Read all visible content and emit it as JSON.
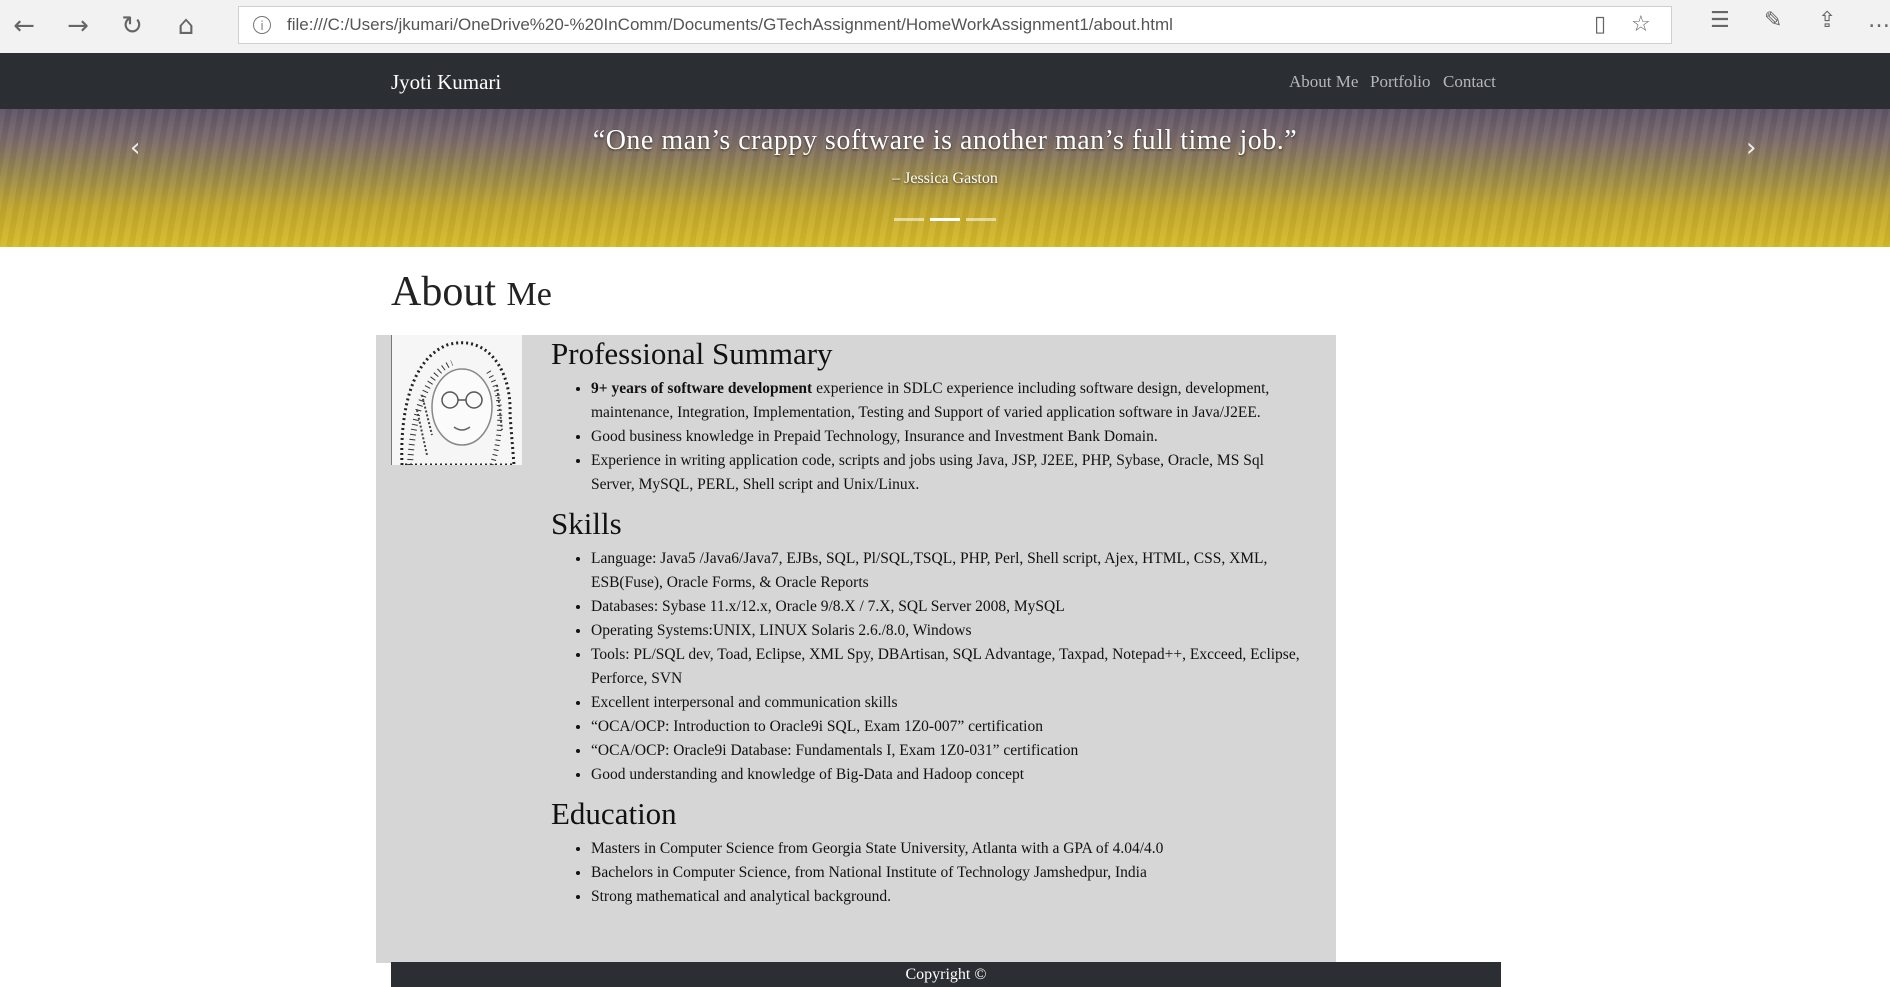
{
  "browser": {
    "url": "file:///C:/Users/jkumari/OneDrive%20-%20InComm/Documents/GTechAssignment/HomeWorkAssignment1/about.html",
    "icons": [
      "back-icon",
      "forward-icon",
      "refresh-icon",
      "home-icon",
      "info-icon",
      "reading-view-icon",
      "favorite-star-icon",
      "favorites-list-icon",
      "pen-icon",
      "share-icon",
      "more-icon"
    ]
  },
  "nav": {
    "brand": "Jyoti Kumari",
    "links": [
      "About Me",
      "Portfolio",
      "Contact"
    ]
  },
  "carousel": {
    "quote": "“One man’s crappy software is another man’s full time job.”",
    "author": "– Jessica Gaston",
    "prev_glyph": "‹",
    "next_glyph": "›",
    "active_index": 1,
    "slide_count": 3
  },
  "page": {
    "title_word1": "About",
    "title_word2": "Me"
  },
  "sections": {
    "summary": {
      "heading": "Professional Summary",
      "item1_bold": "9+ years of software development",
      "item1_rest": " experience in SDLC experience including software design, development, maintenance, Integration, Implementation, Testing and Support of varied application software in Java/J2EE.",
      "items": [
        "Good business knowledge in Prepaid Technology, Insurance and Investment Bank Domain.",
        "Experience in writing application code, scripts and jobs using Java, JSP, J2EE, PHP, Sybase, Oracle, MS Sql Server, MySQL, PERL, Shell script and Unix/Linux."
      ]
    },
    "skills": {
      "heading": "Skills",
      "items": [
        "Language: Java5 /Java6/Java7, EJBs, SQL, Pl/SQL,TSQL, PHP, Perl, Shell script, Ajex, HTML, CSS, XML, ESB(Fuse), Oracle Forms, & Oracle Reports",
        "Databases: Sybase 11.x/12.x, Oracle 9/8.X / 7.X, SQL Server 2008, MySQL",
        "Operating Systems:UNIX, LINUX Solaris 2.6./8.0, Windows",
        "Tools: PL/SQL dev, Toad, Eclipse, XML Spy, DBArtisan, SQL Advantage, Taxpad, Notepad++, Excceed, Eclipse, Perforce, SVN",
        "Excellent interpersonal and communication skills",
        "“OCA/OCP: Introduction to Oracle9i SQL, Exam 1Z0-007” certification",
        "“OCA/OCP: Oracle9i Database: Fundamentals I, Exam 1Z0-031” certification",
        "Good understanding and knowledge of Big-Data and Hadoop concept"
      ]
    },
    "education": {
      "heading": "Education",
      "items": [
        "Masters in Computer Science from Georgia State University, Atlanta with a GPA of 4.04/4.0",
        "Bachelors in Computer Science, from National Institute of Technology Jamshedpur, India",
        "Strong mathematical and analytical background."
      ]
    }
  },
  "footer": {
    "text": "Copyright ©"
  },
  "colors": {
    "navbar": "#2b2e33",
    "panel": "#d6d6d6",
    "carousel_top": "#5f5468",
    "carousel_bottom": "#d6bb2a"
  }
}
